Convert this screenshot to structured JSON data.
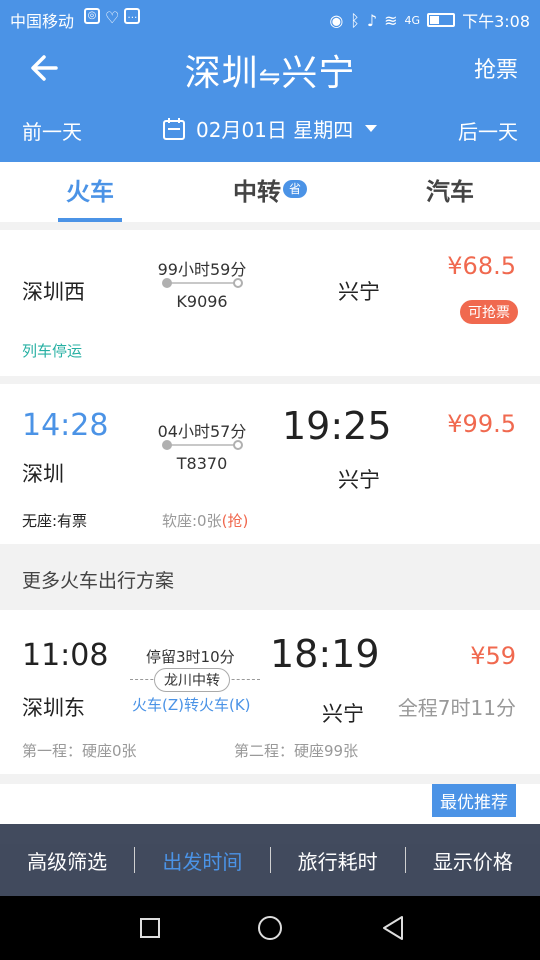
{
  "status_bar": {
    "carrier": "中国移动",
    "signal": "4G",
    "time": "下午3:08"
  },
  "header": {
    "title_from": "深圳",
    "title_arrow": "⇋",
    "title_to": "兴宁",
    "grab_label": "抢票",
    "prev_day": "前一天",
    "next_day": "后一天",
    "date": "02月01日 星期四"
  },
  "tabs": [
    {
      "label": "火车",
      "active": true
    },
    {
      "label": "中转",
      "badge": "省"
    },
    {
      "label": "汽车"
    }
  ],
  "trains": [
    {
      "dep_station": "深圳西",
      "arr_station": "兴宁",
      "duration": "99小时59分",
      "train_no": "K9096",
      "price": "¥68.5",
      "tag": "可抢票",
      "status": "列车停运"
    },
    {
      "dep_time": "14:28",
      "dep_station": "深圳",
      "arr_time": "19:25",
      "arr_station": "兴宁",
      "duration": "04小时57分",
      "train_no": "T8370",
      "price": "¥99.5",
      "seat_info_1": "无座:有票",
      "seat_info_2": "软座:0张",
      "seat_info_2_suffix": "(抢)"
    }
  ],
  "more_section": {
    "title": "更多火车出行方案"
  },
  "transfers": [
    {
      "dep_time": "11:08",
      "dep_station": "深圳东",
      "arr_time": "18:19",
      "arr_station": "兴宁",
      "stopover": "停留3时10分",
      "via": "龙川中转",
      "mode": "火车(Z)转火车(K)",
      "price": "¥59",
      "total": "全程7时11分",
      "leg1": "第一程：硬座0张",
      "leg2": "第二程：硬座99张"
    },
    {
      "recommend": "最优推荐"
    }
  ],
  "bottom_bar": {
    "filter": "高级筛选",
    "depart_time": "出发时间",
    "travel_time": "旅行耗时",
    "show_price": "显示价格"
  },
  "colors": {
    "accent": "#4b93e6",
    "price": "#f0694f",
    "status_green": "#27b0a3"
  }
}
